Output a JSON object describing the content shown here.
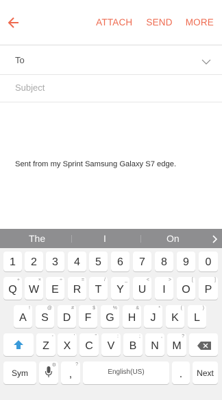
{
  "header": {
    "actions": {
      "attach": "ATTACH",
      "send": "SEND",
      "more": "MORE"
    },
    "accent_color": "#ee6a4f"
  },
  "compose": {
    "to_label": "To",
    "subject_placeholder": "Subject",
    "signature": "Sent from my Sprint Samsung Galaxy S7 edge."
  },
  "keyboard": {
    "suggestions": [
      "The",
      "I",
      "On"
    ],
    "number_row": [
      "1",
      "2",
      "3",
      "4",
      "5",
      "6",
      "7",
      "8",
      "9",
      "0"
    ],
    "row1": [
      {
        "key": "Q",
        "sub": "+"
      },
      {
        "key": "W",
        "sub": "×"
      },
      {
        "key": "E",
        "sub": "÷"
      },
      {
        "key": "R",
        "sub": "="
      },
      {
        "key": "T",
        "sub": "/"
      },
      {
        "key": "Y",
        "sub": "_"
      },
      {
        "key": "U",
        "sub": "<"
      },
      {
        "key": "I",
        "sub": ">"
      },
      {
        "key": "O",
        "sub": "["
      },
      {
        "key": "P",
        "sub": "]"
      }
    ],
    "row2": [
      {
        "key": "A",
        "sub": "!"
      },
      {
        "key": "S",
        "sub": "@"
      },
      {
        "key": "D",
        "sub": "#"
      },
      {
        "key": "F",
        "sub": "$"
      },
      {
        "key": "G",
        "sub": "%"
      },
      {
        "key": "H",
        "sub": "&"
      },
      {
        "key": "J",
        "sub": "*"
      },
      {
        "key": "K",
        "sub": "("
      },
      {
        "key": "L",
        "sub": ")"
      }
    ],
    "row3": [
      {
        "key": "Z",
        "sub": "-"
      },
      {
        "key": "X",
        "sub": "'"
      },
      {
        "key": "C",
        "sub": "\""
      },
      {
        "key": "V",
        "sub": ":"
      },
      {
        "key": "B",
        "sub": ";"
      },
      {
        "key": "N",
        "sub": ","
      },
      {
        "key": "M",
        "sub": "?"
      }
    ],
    "sym_label": "Sym",
    "comma_label": ",",
    "comma_sub": "?",
    "space_label": "English(US)",
    "period_label": ".",
    "next_label": "Next",
    "shift_color": "#3a9ad9"
  }
}
